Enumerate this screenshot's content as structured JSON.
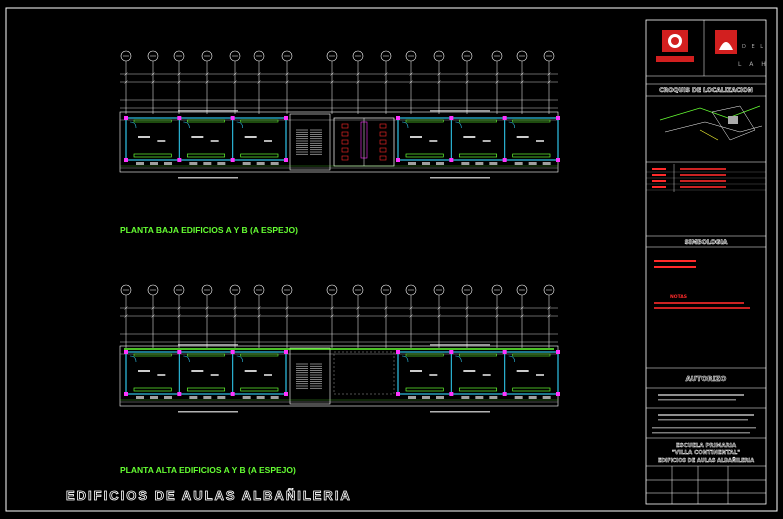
{
  "plans": {
    "ground_title": "PLANTA BAJA EDIFICIOS A Y B (A ESPEJO)",
    "upper_title": "PLANTA ALTA EDIFICIOS A Y B (A ESPEJO)",
    "drawing_title": "EDIFICIOS DE AULAS ALBAÑILERIA"
  },
  "title_block": {
    "croquis_title": "CROQUIS DE LOCALIZACION",
    "simbologia_title": "SIMBOLOGIA",
    "notas_title": "NOTAS",
    "autorizo_title": "AUTORIZO",
    "project_name": "ESCUELA PRIMARIA",
    "project_subname": "\"VILLA CONTINENTAL\"",
    "sheet_desc": "EDIFICIOS DE AULAS ALBAÑILERIA"
  },
  "colors": {
    "frame": "#ffffff",
    "wall": "#2ec3e8",
    "column": "#ff33ff",
    "stair": "#ffffff",
    "accent_green": "#66ff33",
    "red": "#ff2a2a",
    "yellow": "#ffff33",
    "grey": "#a0a0a0"
  }
}
